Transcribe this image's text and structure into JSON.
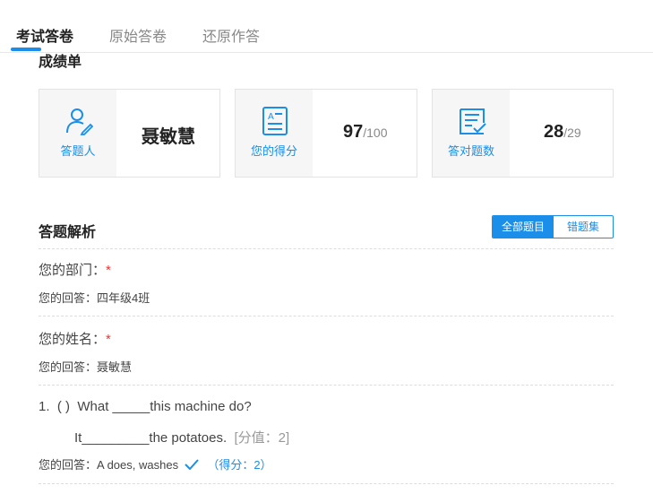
{
  "tabs": [
    "考试答卷",
    "原始答卷",
    "还原作答"
  ],
  "report_title": "成绩单",
  "cards": {
    "respondent": {
      "icon": "user-icon",
      "label": "答题人",
      "value": "聂敏慧"
    },
    "score": {
      "icon": "score-sheet-icon",
      "label": "您的得分",
      "value": "97",
      "total": "/100"
    },
    "correct": {
      "icon": "checklist-icon",
      "label": "答对题数",
      "value": "28",
      "total": "/29"
    }
  },
  "analysis": {
    "title": "答题解析",
    "filters": [
      "全部题目",
      "错题集"
    ]
  },
  "questions": [
    {
      "title": "您的部门：",
      "required": "*",
      "answer_prefix": "您的回答：",
      "answer": "四年级4班"
    },
    {
      "title": "您的姓名：",
      "required": "*",
      "answer_prefix": "您的回答：",
      "answer": "聂敏慧"
    },
    {
      "number": "1.",
      "bracket": "(  )",
      "text": "What _____this machine do?",
      "line2": "It_________the potatoes.",
      "points": "[分值：2]",
      "answer_prefix": "您的回答：",
      "answer": "A does, washes",
      "result_icon": "checkmark-icon",
      "score": "（得分：2）"
    }
  ],
  "colors": {
    "accent": "#1a8ee8",
    "required": "#e33333"
  }
}
